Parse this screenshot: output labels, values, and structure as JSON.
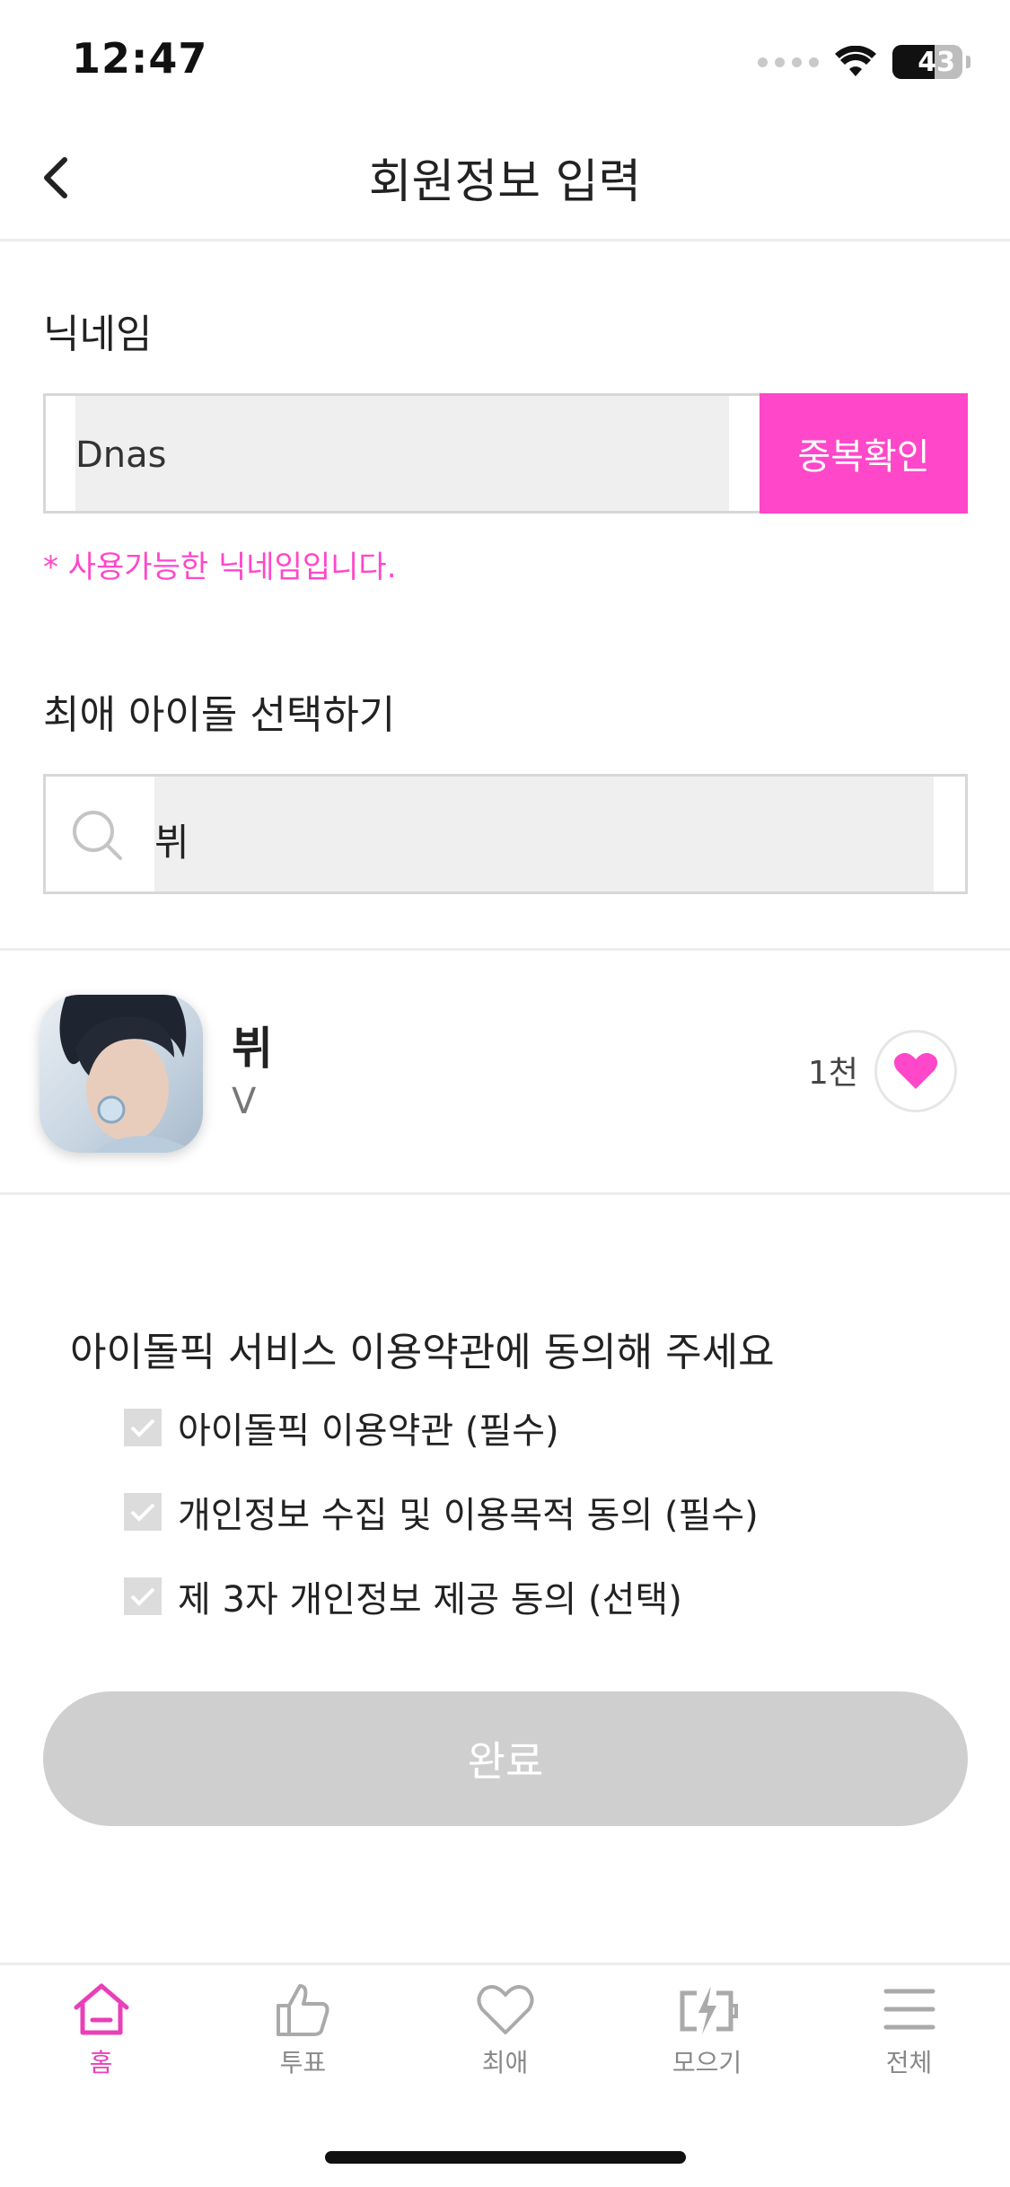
{
  "status_bar": {
    "time": "12:47",
    "battery": "43"
  },
  "header": {
    "title": "회원정보 입력"
  },
  "nickname": {
    "label": "닉네임",
    "value": "Dnas",
    "check_button": "중복확인",
    "status_message": "* 사용가능한 닉네임입니다."
  },
  "idol_search": {
    "label": "최애 아이돌 선택하기",
    "query": "뷔"
  },
  "idol_result": {
    "name": "뷔",
    "sub_name": "V",
    "count": "1천"
  },
  "terms": {
    "title": "아이돌픽 서비스 이용약관에 동의해 주세요",
    "items": [
      {
        "label": "아이돌픽 이용약관 (필수)",
        "checked": true
      },
      {
        "label": "개인정보 수집 및 이용목적 동의 (필수)",
        "checked": true
      },
      {
        "label": "제 3자 개인정보 제공 동의 (선택)",
        "checked": true
      }
    ]
  },
  "done_button": "완료",
  "tabs": [
    {
      "label": "홈",
      "icon": "home-icon",
      "active": true
    },
    {
      "label": "투표",
      "icon": "thumbs-up-icon",
      "active": false
    },
    {
      "label": "최애",
      "icon": "heart-icon",
      "active": false
    },
    {
      "label": "모으기",
      "icon": "charge-icon",
      "active": false
    },
    {
      "label": "전체",
      "icon": "menu-icon",
      "active": false
    }
  ],
  "colors": {
    "accent": "#ff47c9",
    "tab_active": "#e93fb8",
    "disabled_button": "#cfcfcf"
  }
}
